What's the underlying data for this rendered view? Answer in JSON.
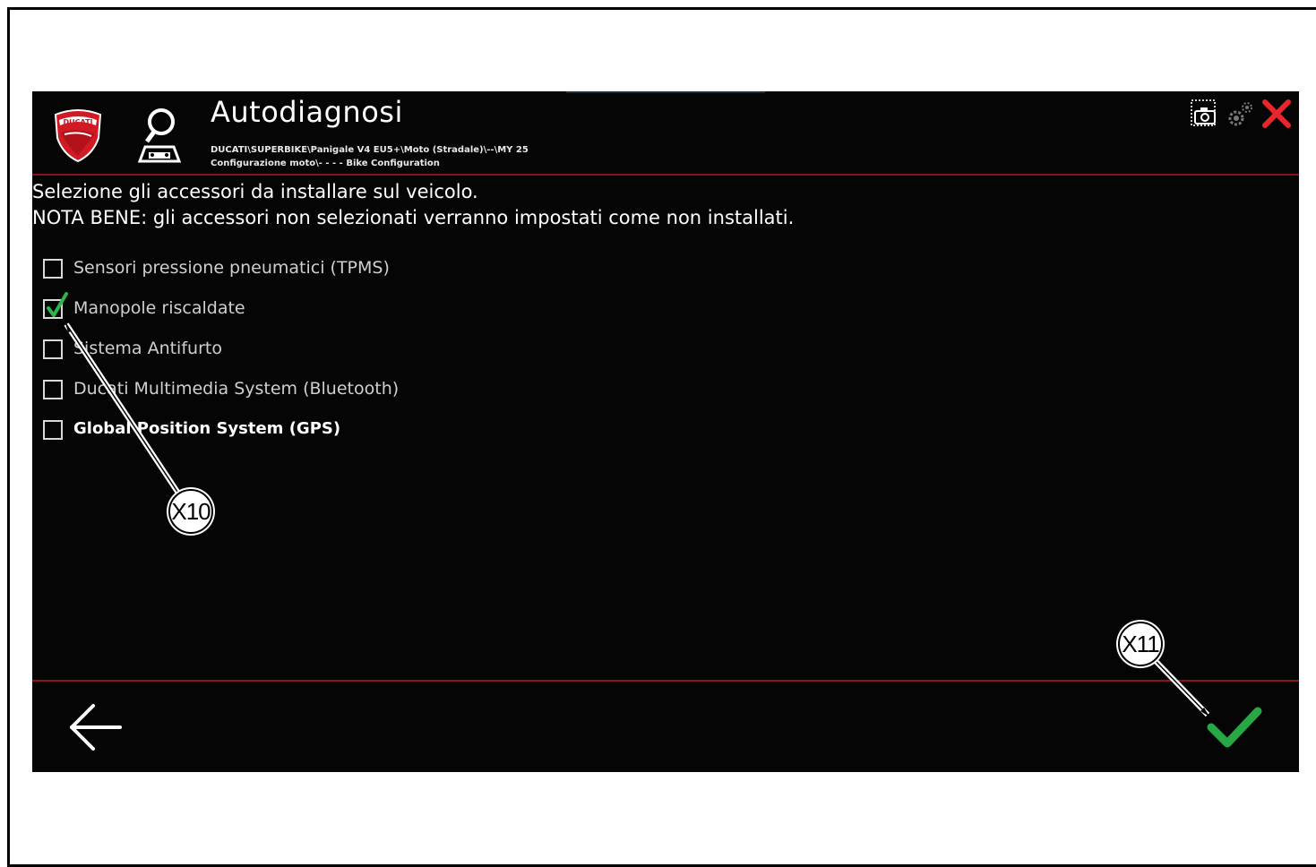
{
  "header": {
    "title": "Autodiagnosi",
    "path_line1": "DUCATI\\SUPERBIKE\\Panigale V4 EU5+\\Moto (Stradale)\\--\\MY 25",
    "path_line2": "Configurazione moto\\- - - - Bike Configuration",
    "logo_text": "DUCATI",
    "icons": [
      "camera-icon",
      "settings-gear-icon",
      "close-icon"
    ]
  },
  "instructions": {
    "line1": "Selezione gli accessori da installare sul veicolo.",
    "line2": "NOTA BENE: gli accessori non selezionati verranno impostati come non installati."
  },
  "accessories": [
    {
      "label": "Sensori pressione pneumatici (TPMS)",
      "checked": false
    },
    {
      "label": "Manopole riscaldate",
      "checked": true
    },
    {
      "label": "Sistema Antifurto",
      "checked": false
    },
    {
      "label": "Ducati Multimedia System (Bluetooth)",
      "checked": false
    },
    {
      "label": "Global Position System (GPS)",
      "checked": false
    }
  ],
  "footer": {
    "back_icon": "arrow-left-icon",
    "confirm_icon": "checkmark-icon"
  },
  "callouts": {
    "x10": "X10",
    "x11": "X11"
  },
  "colors": {
    "background": "#050505",
    "divider": "#8b1218",
    "close": "#e8262b",
    "confirm": "#27a844",
    "check": "#2fb34a"
  }
}
